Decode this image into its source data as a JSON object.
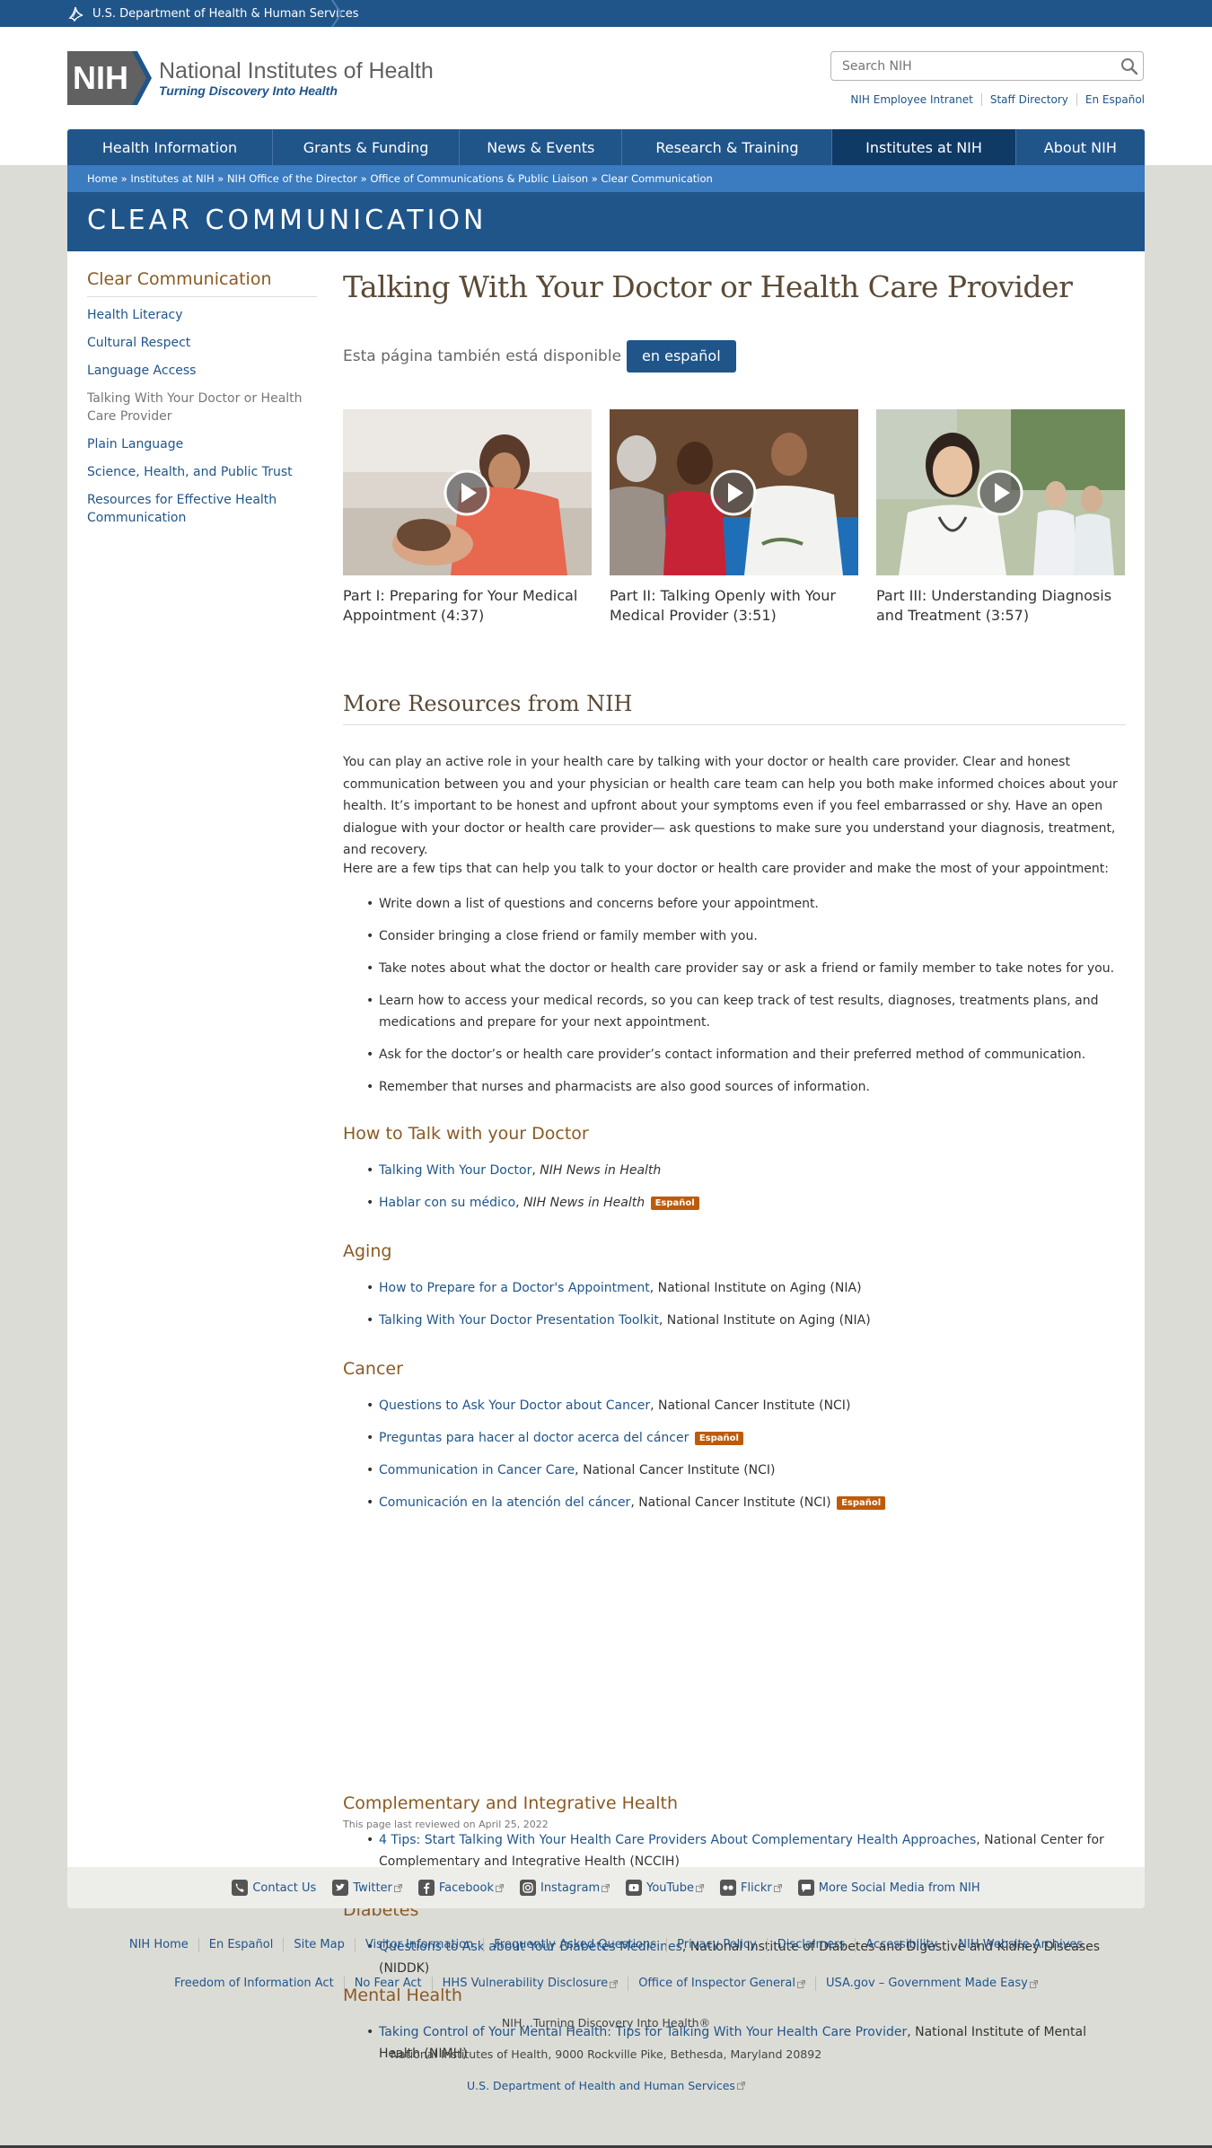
{
  "hhs": {
    "label": "U.S. Department of Health & Human Services"
  },
  "header": {
    "logo_mark": "NIH",
    "logo_title": "National Institutes of Health",
    "logo_tagline": "Turning Discovery Into Health",
    "search_placeholder": "Search NIH",
    "utility_links": [
      "NIH Employee Intranet",
      "Staff Directory",
      "En Español"
    ]
  },
  "nav": {
    "items": [
      "Health Information",
      "Grants & Funding",
      "News & Events",
      "Research & Training",
      "Institutes at NIH",
      "About NIH"
    ],
    "active": "Institutes at NIH"
  },
  "breadcrumb": [
    "Home",
    "Institutes at NIH",
    "NIH Office of the Director",
    "Office of Communications & Public Liaison",
    "Clear Communication"
  ],
  "banner": {
    "title": "CLEAR COMMUNICATION"
  },
  "sidebar": {
    "title": "Clear Communication",
    "items": [
      "Health Literacy",
      "Cultural Respect",
      "Language Access",
      "Talking With Your Doctor or Health Care Provider",
      "Plain Language",
      "Science, Health, and Public Trust",
      "Resources for Effective Health Communication"
    ],
    "current": "Talking With Your Doctor or Health Care Provider"
  },
  "main": {
    "title": "Talking With Your Doctor or Health Care Provider",
    "spanish_prompt": "Esta página también está disponible",
    "spanish_button": "en español",
    "videos": [
      {
        "caption": "Part I: Preparing for Your Medical Appointment (4:37)"
      },
      {
        "caption": "Part II: Talking Openly with Your Medical Provider (3:51)"
      },
      {
        "caption": "Part III: Understanding Diagnosis and Treatment (3:57)"
      }
    ],
    "more_heading": "More Resources from NIH",
    "intro": "You can play an active role in your health care by talking with your doctor or health care provider. Clear and honest communication between you and your physician or health care team can help you both make informed choices about your health. It’s important to be honest and upfront about your symptoms even if you feel embarrassed or shy. Have an open dialogue with your doctor or health care provider— ask questions to make sure you understand your diagnosis, treatment, and recovery.",
    "tips_intro": "Here are a few tips that can help you talk to your doctor or health care provider and make the most of your appointment:",
    "tips": [
      "Write down a list of questions and concerns before your appointment.",
      "Consider bringing a close friend or family member with you.",
      "Take notes about what the doctor or health care provider say or ask a friend or family member to take notes for you.",
      "Learn how to access your medical records, so you can keep track of test results, diagnoses, treatments plans, and medications and prepare for your next appointment.",
      "Ask for the doctor’s or health care provider’s contact information and their preferred method of communication.",
      "Remember that nurses and pharmacists are also good sources of information."
    ],
    "badge_label": "Español",
    "sections": [
      {
        "heading": "How to Talk with your Doctor",
        "items": [
          {
            "link": "Talking With Your Doctor",
            "source": ", ",
            "pub": "NIH News in Health"
          },
          {
            "link": "Hablar con su médico",
            "source": ", ",
            "pub": "NIH News in Health"
          }
        ]
      },
      {
        "heading": "Aging",
        "items": [
          {
            "link": "How to Prepare for a Doctor's Appointment",
            "source": ", National Institute on Aging (NIA)"
          },
          {
            "link": "Talking With Your Doctor Presentation Toolkit",
            "source": ", National Institute on Aging (NIA)"
          }
        ]
      },
      {
        "heading": "Cancer",
        "items": [
          {
            "link": "Questions to Ask Your Doctor about Cancer",
            "source": ", National Cancer Institute (NCI)"
          },
          {
            "link": "Preguntas para hacer al doctor acerca del cáncer",
            "source": " "
          },
          {
            "link": "Communication in Cancer Care",
            "source": ", National Cancer Institute (NCI)"
          },
          {
            "link": "Comunicación en la atención del cáncer",
            "source": ", National Cancer Institute (NCI)"
          }
        ]
      },
      {
        "heading": "Complementary and Integrative Health",
        "items": [
          {
            "link": "4 Tips: Start Talking With Your Health Care Providers About Complementary Health Approaches",
            "source": ", National Center for Complementary and Integrative Health (NCCIH)"
          }
        ]
      },
      {
        "heading": "Diabetes",
        "items": [
          {
            "link": "Questions to Ask about Your Diabetes Medicines",
            "source": ", National Institute of Diabetes and Digestive and Kidney Diseases (NIDDK)"
          }
        ]
      },
      {
        "heading": "Mental Health",
        "items": [
          {
            "link": "Taking Control of Your Mental Health: Tips for Talking With Your Health Care Provider",
            "source": ", National Institute of Mental Health (NIMH)"
          }
        ]
      }
    ],
    "reviewed": "This page last reviewed on April 25, 2022"
  },
  "social": {
    "items": [
      {
        "label": "Contact Us",
        "icon": "phone-icon"
      },
      {
        "label": "Twitter",
        "icon": "twitter-icon"
      },
      {
        "label": "Facebook",
        "icon": "facebook-icon"
      },
      {
        "label": "Instagram",
        "icon": "instagram-icon"
      },
      {
        "label": "YouTube",
        "icon": "youtube-icon"
      },
      {
        "label": "Flickr",
        "icon": "flickr-icon"
      },
      {
        "label": "More Social Media from NIH",
        "icon": "social-media-icon"
      }
    ]
  },
  "footer": {
    "links_row1": [
      "NIH Home",
      "En Español",
      "Site Map",
      "Visitor Information",
      "Frequently Asked Questions",
      "Privacy Policy",
      "Disclaimers",
      "Accessibility",
      "NIH Website Archives"
    ],
    "links_row2": [
      "Freedom of Information Act",
      "No Fear Act",
      "HHS Vulnerability Disclosure",
      "Office of Inspector General",
      "USA.gov – Government Made Easy"
    ],
    "tagline": "NIH…Turning Discovery Into Health®",
    "address": "National Institutes of Health, 9000 Rockville Pike, Bethesda, Maryland 20892",
    "hhs_link": "U.S. Department of Health and Human Services"
  },
  "colors": {
    "primary_blue": "#20558a",
    "breadcrumb_blue": "#3b7bbf",
    "heading_brown": "#8a5a24",
    "badge_orange": "#bd5b0a",
    "page_bg": "#dcdcd7"
  }
}
